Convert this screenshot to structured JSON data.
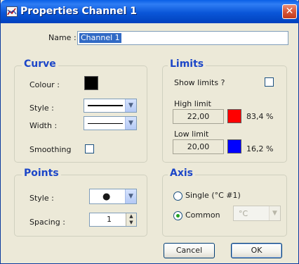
{
  "window": {
    "title": "Properties Channel 1",
    "close_symbol": "✕"
  },
  "name_field": {
    "label": "Name :",
    "value": "Channel 1"
  },
  "curve": {
    "title": "Curve",
    "colour_label": "Colour :",
    "colour": "#000000",
    "style_label": "Style :",
    "width_label": "Width :",
    "smoothing_label": "Smoothing",
    "smoothing_checked": false
  },
  "limits": {
    "title": "Limits",
    "show_limits_label": "Show limits ?",
    "show_limits_checked": false,
    "high_label": "High limit",
    "high_value": "22,00",
    "high_color": "#ff0000",
    "high_percent": "83,4 %",
    "low_label": "Low limit",
    "low_value": "20,00",
    "low_color": "#0000ff",
    "low_percent": "16,2 %"
  },
  "points": {
    "title": "Points",
    "style_label": "Style :",
    "style_symbol": "●",
    "spacing_label": "Spacing :",
    "spacing_value": "1"
  },
  "axis": {
    "title": "Axis",
    "single_label": "Single (°C #1)",
    "common_label": "Common",
    "selected": "common",
    "unit_value": "°C"
  },
  "buttons": {
    "cancel": "Cancel",
    "ok": "OK"
  }
}
